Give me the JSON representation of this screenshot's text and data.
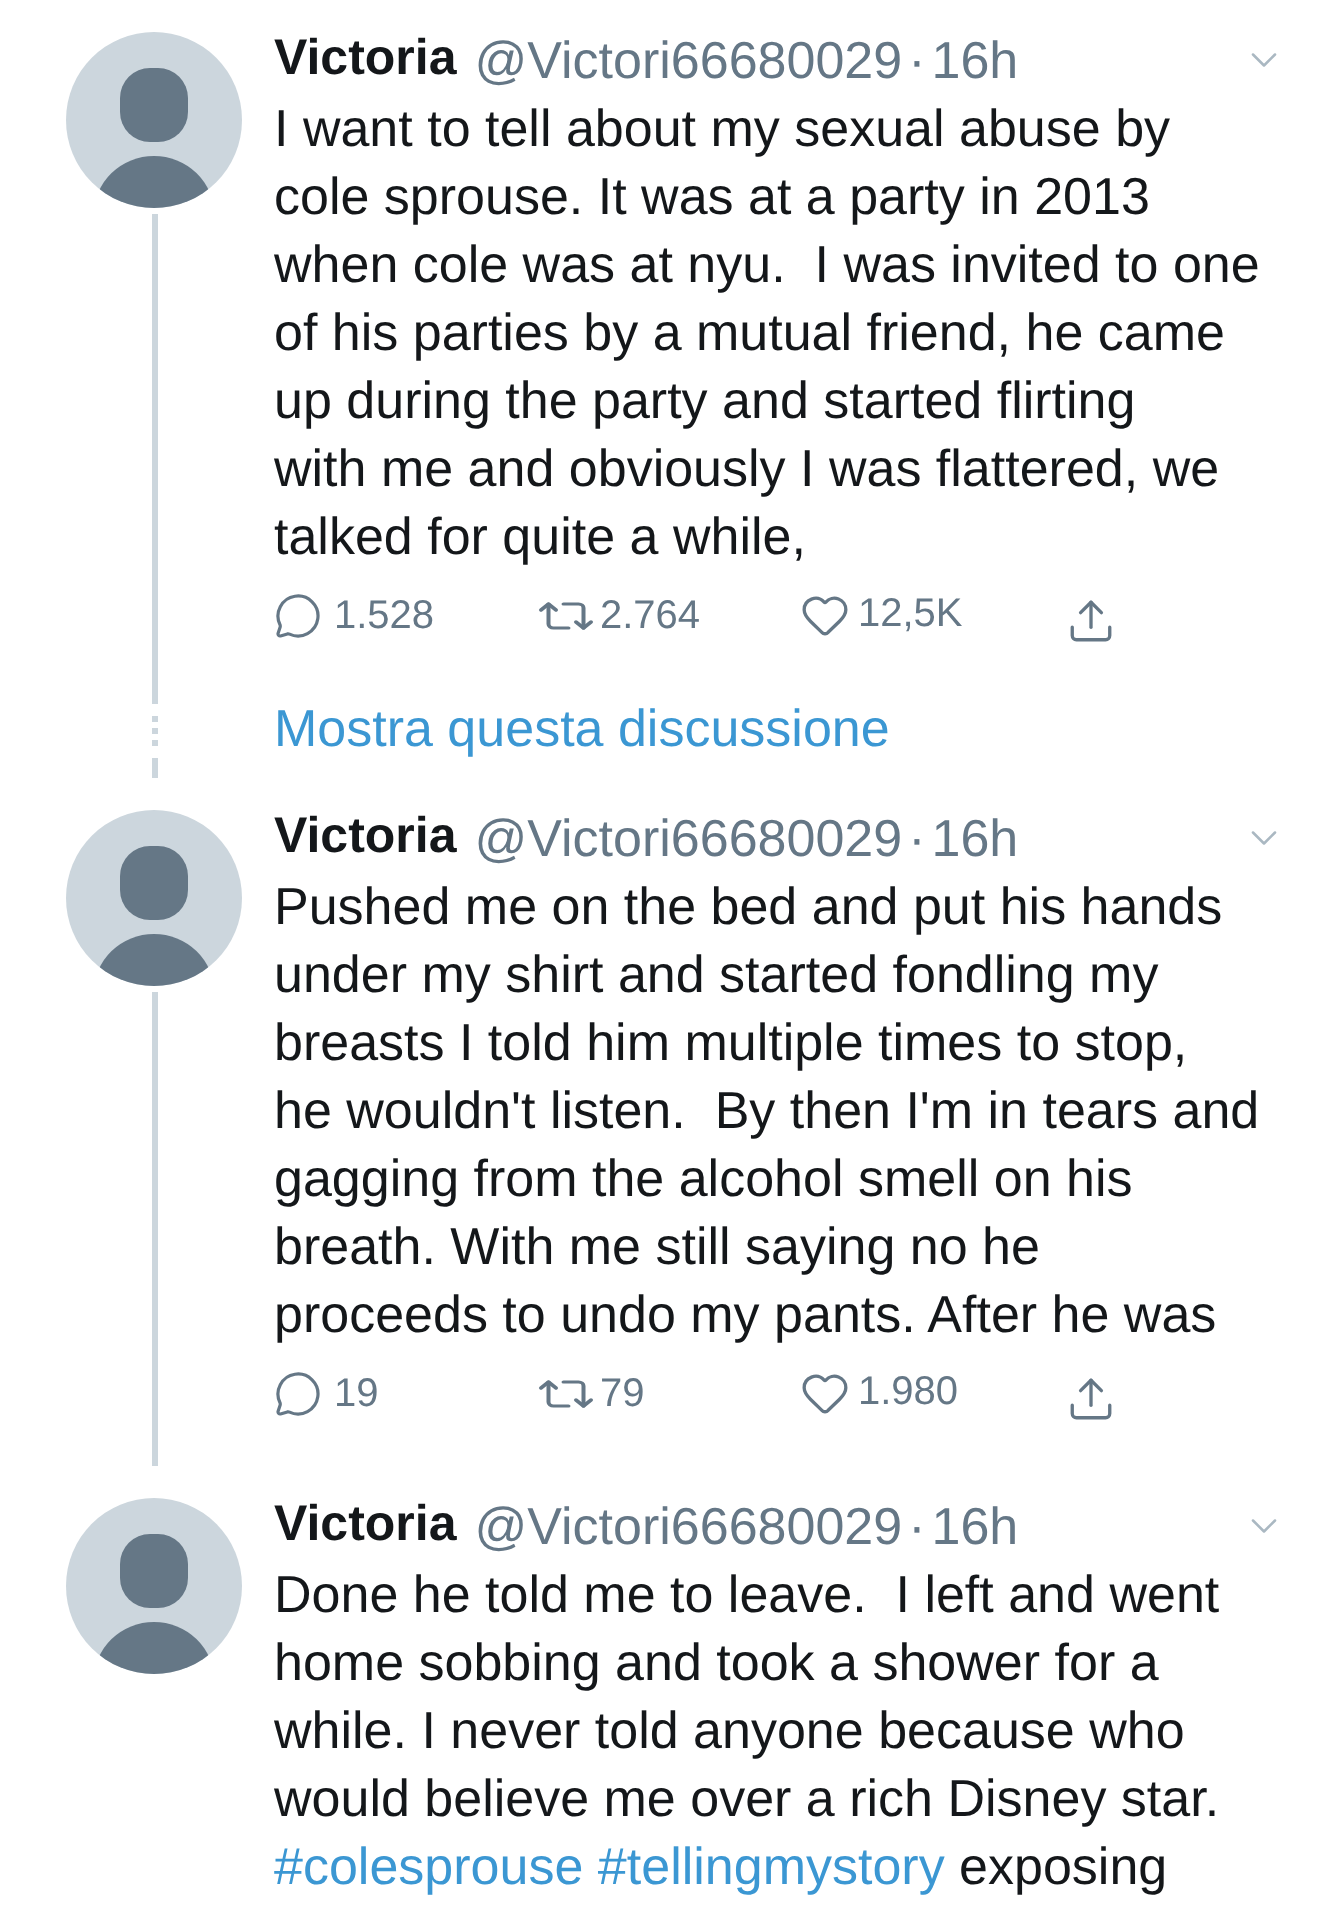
{
  "thread": [
    {
      "kind": "tweet",
      "name": "Victoria",
      "handle": "@Victori66680029",
      "separator": "·",
      "time": "16h",
      "thread_below": true,
      "text": [
        {
          "kind": "text",
          "text": "I want to tell about my sexual abuse by\ncole sprouse. It was at a party in 2013\nwhen cole was at nyu.  I was invited to one\nof his parties by a mutual friend, he came\nup during the party and started flirting\nwith me and obviously I was flattered, we\ntalked for quite a while,"
        }
      ],
      "actions": {
        "replies": "1.528",
        "retweets": "2.764",
        "likes": "12,5K"
      }
    },
    {
      "kind": "show_thread",
      "label": "Mostra questa discussione"
    },
    {
      "kind": "tweet",
      "name": "Victoria",
      "handle": "@Victori66680029",
      "separator": "·",
      "time": "16h",
      "thread_below": true,
      "text": [
        {
          "kind": "text",
          "text": "Pushed me on the bed and put his hands\nunder my shirt and started fondling my\nbreasts I told him multiple times to stop,\nhe wouldn't listen.  By then I'm in tears and\ngagging from the alcohol smell on his\nbreath. With me still saying no he\nproceeds to undo my pants. After he was"
        }
      ],
      "actions": {
        "replies": "19",
        "retweets": "79",
        "likes": "1.980"
      }
    },
    {
      "kind": "tweet",
      "name": "Victoria",
      "handle": "@Victori66680029",
      "separator": "·",
      "time": "16h",
      "thread_below": false,
      "text": [
        {
          "kind": "text",
          "text": "Done he told me to leave.  I left and went\nhome sobbing and took a shower for a\nwhile. I never told anyone because who\nwould believe me over a rich Disney star.\n"
        },
        {
          "kind": "hashtag",
          "text": "#colesprouse"
        },
        {
          "kind": "hashtag",
          "text": "#tellingmystory"
        },
        {
          "kind": "text",
          "text": " exposing"
        }
      ]
    }
  ]
}
